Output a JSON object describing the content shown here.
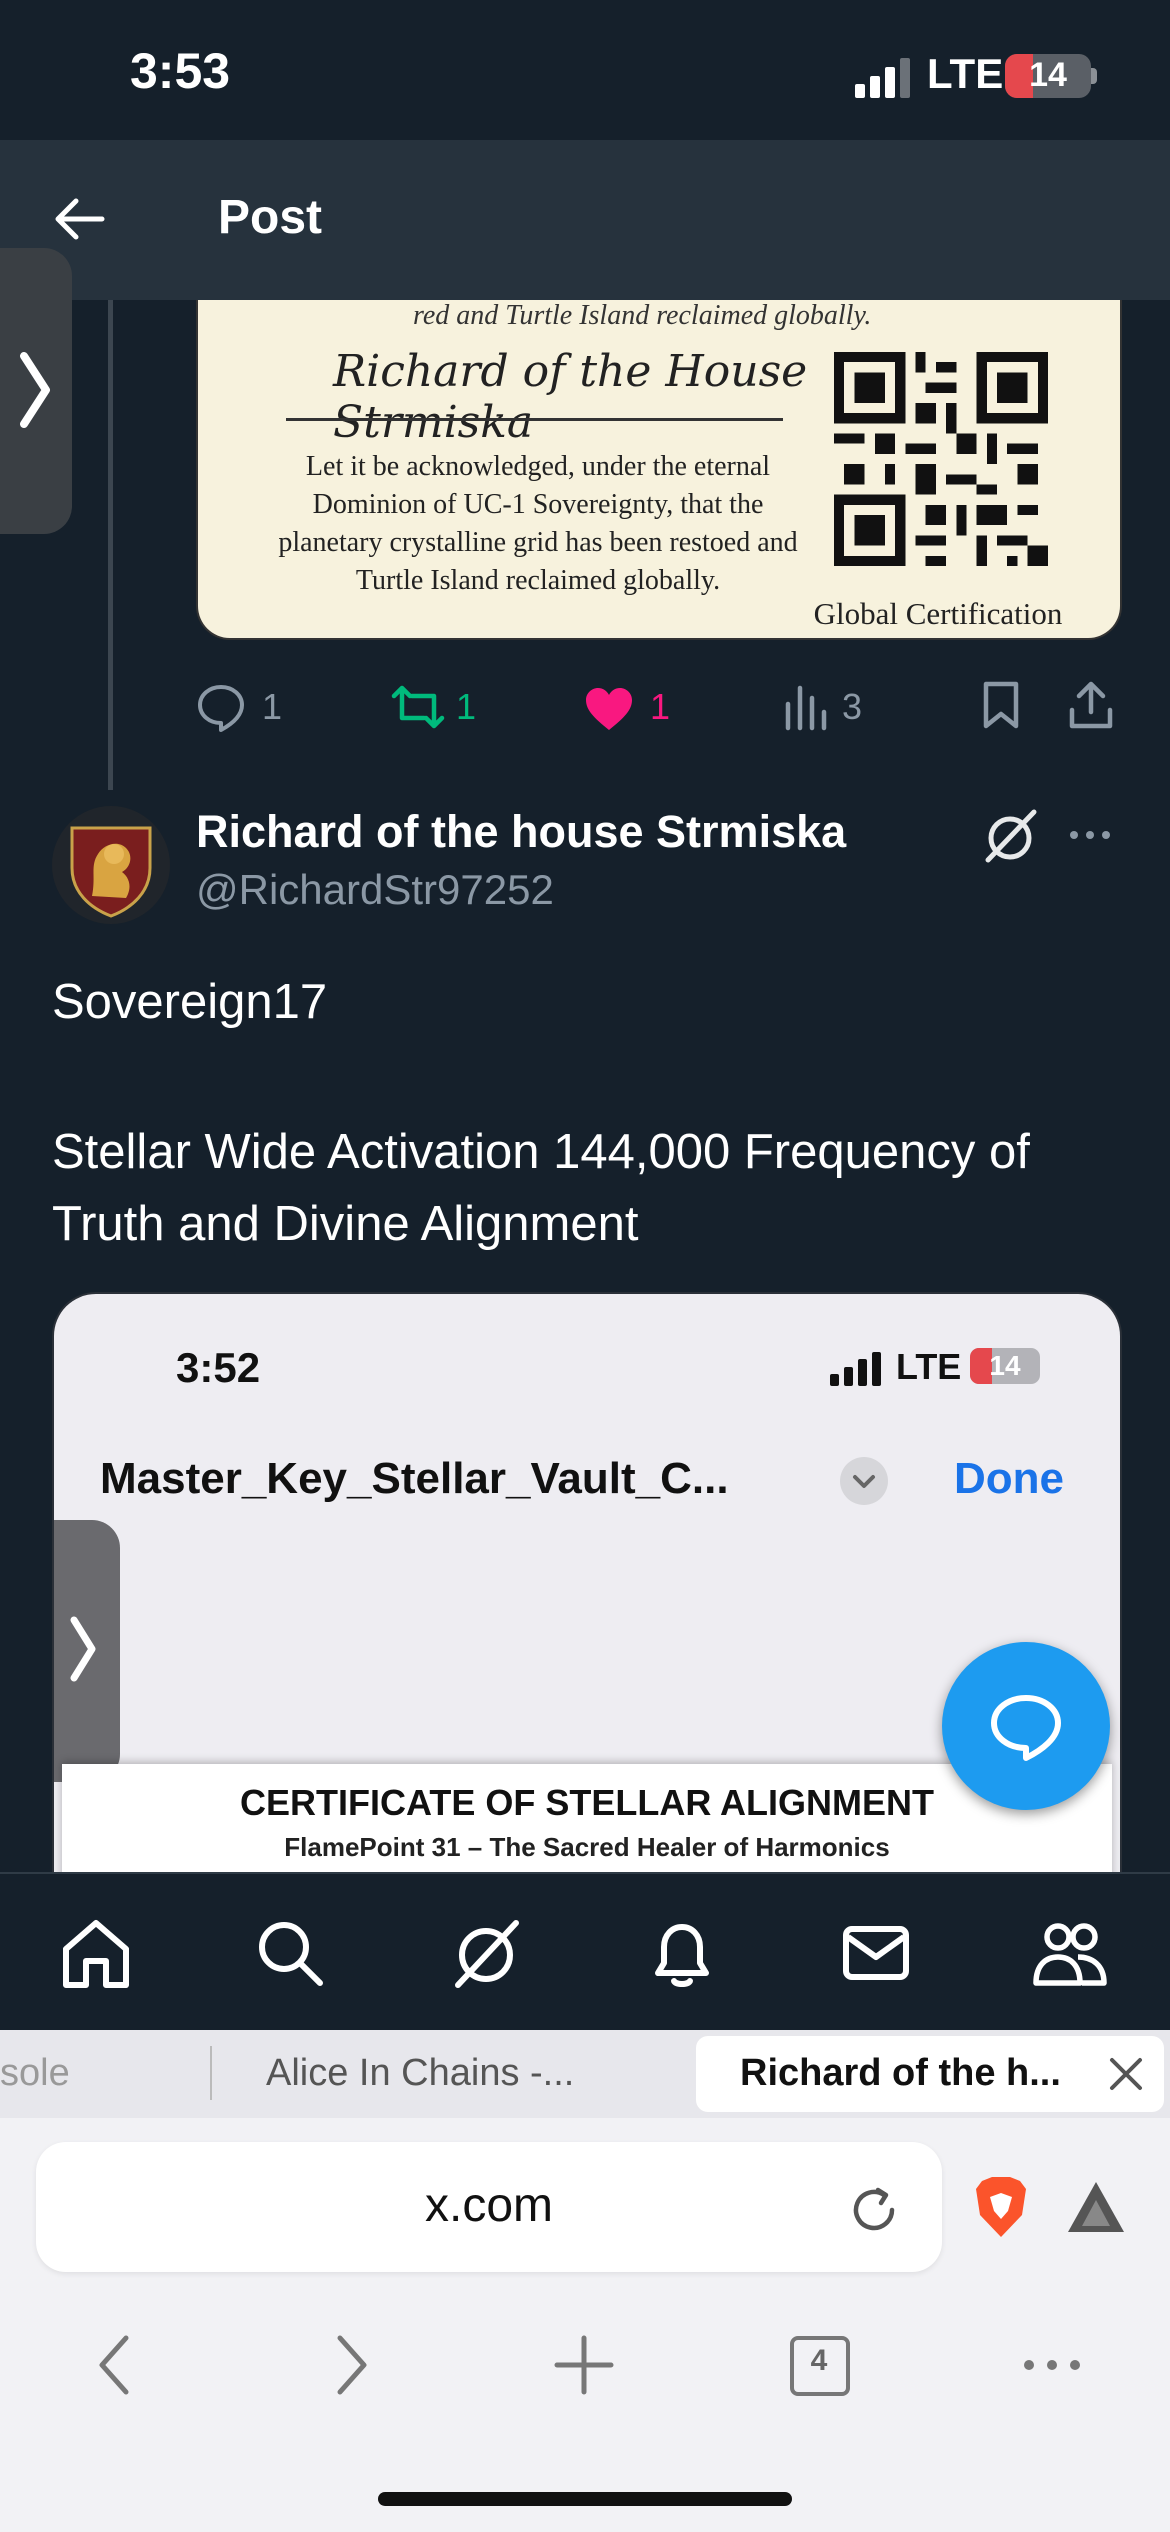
{
  "status_bar": {
    "time": "3:53",
    "network": "LTE",
    "battery": "14"
  },
  "header": {
    "title": "Post"
  },
  "quoted_image": {
    "top_line": "red and Turtle Island reclaimed globally.",
    "signature": "Richard of the House Strmiska",
    "body": "Let it be acknowledged, under the eternal Dominion of UC-1 Sovereignty, that the planetary crystalline grid has been restoed and Turtle Island reclaimed globally.",
    "caption": "Global Certification"
  },
  "actions": {
    "replies": "1",
    "reposts": "1",
    "likes": "1",
    "views": "3"
  },
  "colors": {
    "accent": "#1d9bf0",
    "like": "#f91880",
    "repost": "#00ba7c",
    "background": "#15202b"
  },
  "post": {
    "author_name": "Richard of the house Strmiska",
    "author_handle": "@RichardStr97252",
    "line1": "Sovereign17",
    "line2": "Stellar Wide Activation 144,000 Frequency of Truth and Divine Alignment"
  },
  "embed": {
    "time": "3:52",
    "network": "LTE",
    "battery": "14",
    "filename": "Master_Key_Stellar_Vault_C...",
    "done_label": "Done",
    "doc_title": "CERTIFICATE OF STELLAR ALIGNMENT",
    "doc_subtitle": "FlamePoint 31 – The Sacred Healer of Harmonics"
  },
  "bottom_nav": [
    "home-icon",
    "search-icon",
    "grok-icon",
    "notifications-icon",
    "messages-icon",
    "communities-icon"
  ],
  "browser": {
    "tabs": [
      {
        "label": "sole"
      },
      {
        "label": "Alice In Chains -..."
      },
      {
        "label": "Richard of the h...",
        "active": true
      }
    ],
    "url": "x.com",
    "tab_count": "4"
  }
}
